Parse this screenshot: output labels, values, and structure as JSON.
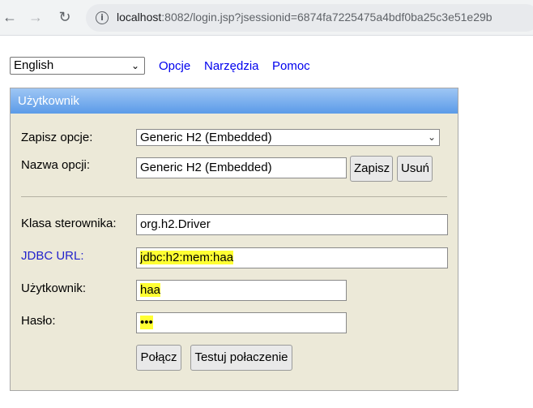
{
  "browser": {
    "url_host": "localhost",
    "url_rest": ":8082/login.jsp?jsessionid=6874fa7225475a4bdf0ba25c3e51e29b"
  },
  "top": {
    "language": "English",
    "links": [
      "Opcje",
      "Narzędzia",
      "Pomoc"
    ]
  },
  "panel": {
    "title": "Użytkownik",
    "saved_settings_label": "Zapisz opcje:",
    "saved_settings_value": "Generic H2 (Embedded)",
    "setting_name_label": "Nazwa opcji:",
    "setting_name_value": "Generic H2 (Embedded)",
    "save_button": "Zapisz",
    "remove_button": "Usuń",
    "driver_label": "Klasa sterownika:",
    "driver_value": "org.h2.Driver",
    "jdbc_label": "JDBC URL:",
    "jdbc_value": "jdbc:h2:mem:haa",
    "user_label": "Użytkownik:",
    "user_value": "haa",
    "password_label": "Hasło:",
    "password_value": "•••",
    "connect_button": "Połącz",
    "test_button": "Testuj połaczenie"
  }
}
